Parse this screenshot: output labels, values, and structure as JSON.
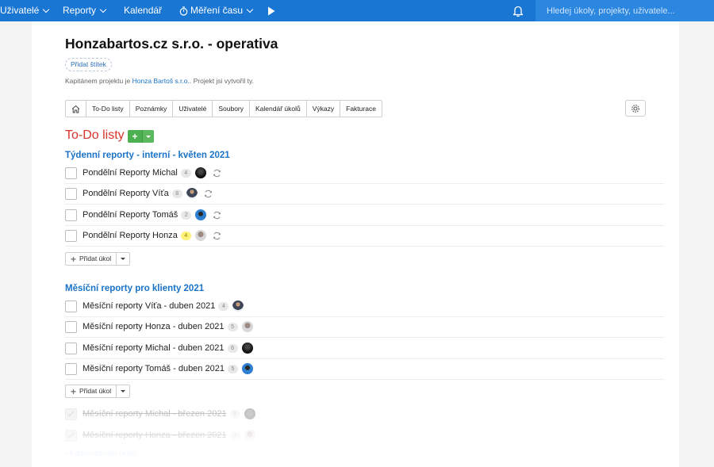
{
  "topbar": {
    "users_label": "Uživatelé",
    "reports_label": "Reporty",
    "calendar_label": "Kalendář",
    "time_label": "Měření času",
    "search_placeholder": "Hledej úkoly, projekty, uživatele..."
  },
  "project": {
    "title": "Honzabartos.cz s.r.o. - operativa",
    "add_tag_label": "Přidat štítek",
    "desc_prefix": "Kapitánem projektu je ",
    "captain": "Honza Bartoš s.r.o.",
    "desc_suffix": ". Projekt jsi vytvořil ty."
  },
  "tabs": [
    "To-Do listy",
    "Poznámky",
    "Uživatelé",
    "Soubory",
    "Kalendář úkolů",
    "Výkazy",
    "Fakturace"
  ],
  "section_title": "To-Do listy",
  "lists": [
    {
      "title": "Týdenní reporty - interní - květen 2021",
      "tasks": [
        {
          "name": "Pondělní Reporty Michal",
          "count": "4"
        },
        {
          "name": "Pondělní Reporty Víťa",
          "count": "8"
        },
        {
          "name": "Pondělní Reporty Tomáš",
          "count": "2"
        },
        {
          "name": "Pondělní Reporty Honza",
          "count": "4"
        }
      ],
      "add_task_label": "Přidat úkol"
    },
    {
      "title": "Měsíční reporty pro klienty 2021",
      "tasks": [
        {
          "name": "Měsíční reporty Víťa - duben 2021",
          "count": "4"
        },
        {
          "name": "Měsíční reporty Honza - duben 2021",
          "count": "5"
        },
        {
          "name": "Měsíční reporty Michal - duben 2021",
          "count": "6"
        },
        {
          "name": "Měsíční reporty Tomáš - duben 2021",
          "count": "5"
        }
      ],
      "add_task_label": "Přidat úkol",
      "completed_tasks": [
        {
          "name": "Měsíční reporty Michal - březen 2021",
          "count": "5"
        },
        {
          "name": "Měsíční reporty Honza - březen 2021",
          "count": "3"
        }
      ],
      "completed_link": "+8 dokončených úkolů"
    }
  ],
  "colors": {
    "topbar": "#1976d2",
    "section_title": "#d9342b",
    "link": "#1a73c8",
    "add_button": "#4caf50"
  }
}
